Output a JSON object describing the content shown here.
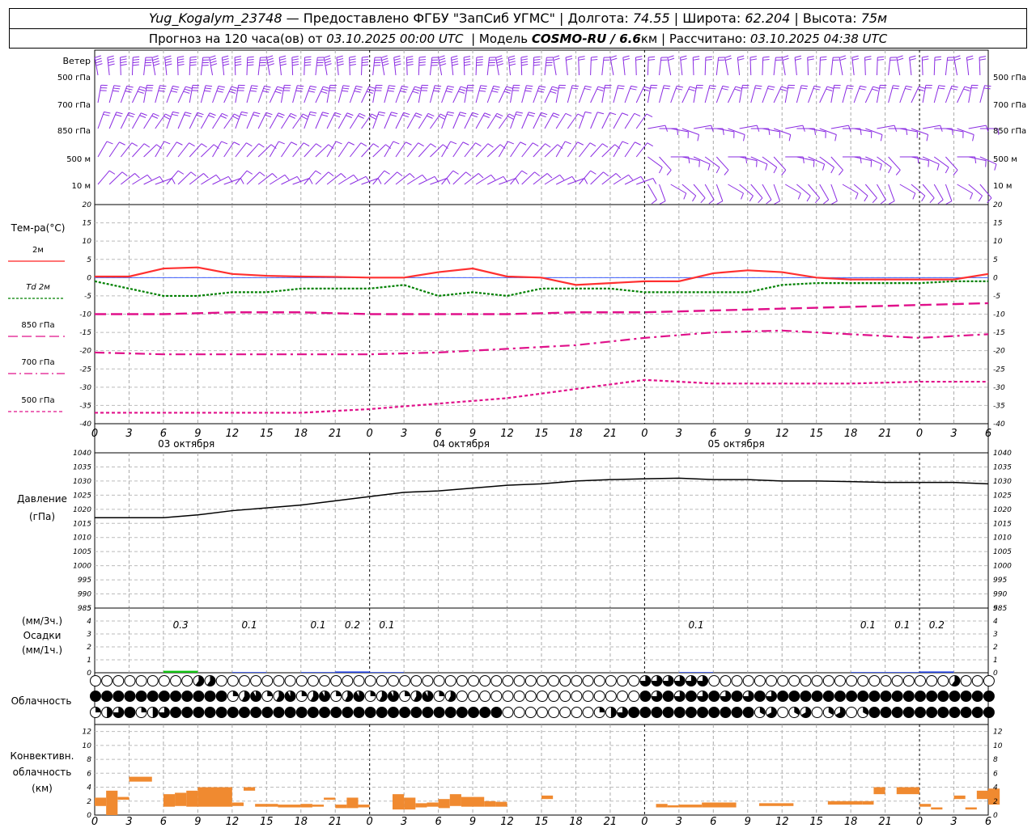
{
  "header": {
    "station": "Yug_Kogalym_23748",
    "provider": "— Предоставлено ФГБУ \"ЗапСиб УГМС\"",
    "lon_label": "Долгота:",
    "lon": "74.55",
    "lat_label": "Широта:",
    "lat": "62.204",
    "alt_label": "Высота:",
    "alt": "75м",
    "forecast_label": "Прогноз на 120 часа(ов) от",
    "forecast_start": "03.10.2025 00:00 UTC",
    "model_label": "Модель",
    "model": "COSMO-RU / 6.6",
    "model_unit": "км",
    "calc_label": "Рассчитано:",
    "calc_time": "03.10.2025 04:38 UTC"
  },
  "axis": {
    "hours": [
      "0",
      "3",
      "6",
      "9",
      "12",
      "15",
      "18",
      "21",
      "0",
      "3",
      "6",
      "9",
      "12",
      "15",
      "18",
      "21",
      "0",
      "3",
      "6",
      "9",
      "12",
      "15",
      "18",
      "21",
      "0",
      "3",
      "6"
    ],
    "dates": [
      "03 октября",
      "04 октября",
      "05 октября"
    ]
  },
  "wind_panel": {
    "title": "Ветер",
    "levels": [
      "500 гПа",
      "700 гПа",
      "850 гПа",
      "500 м",
      "10  м"
    ],
    "color": "#8a2be2"
  },
  "temp_panel": {
    "ylabel": "Тем-ра(°C)",
    "ticks": [
      "20",
      "15",
      "10",
      "5",
      "0",
      "-5",
      "-10",
      "-15",
      "-20",
      "-25",
      "-30",
      "-35",
      "-40"
    ],
    "legend": [
      {
        "label": "2м",
        "color": "#ff2020"
      },
      {
        "label": "Td  2м",
        "color": "#008000"
      },
      {
        "label": "850 гПа",
        "color": "#e0108a"
      },
      {
        "label": "700 гПа",
        "color": "#e0108a"
      },
      {
        "label": "500 гПа",
        "color": "#e0108a"
      }
    ]
  },
  "pressure_panel": {
    "ylabel1": "Давление",
    "ylabel2": "(гПа)",
    "ticks": [
      "1040",
      "1035",
      "1030",
      "1025",
      "1020",
      "1015",
      "1010",
      "1005",
      "1000",
      "995",
      "990",
      "985"
    ]
  },
  "precip_panel": {
    "ylabel1": "(мм/3ч.)",
    "ylabel2": "Осадки",
    "ylabel3": "(мм/1ч.)",
    "ticks": [
      "5",
      "4",
      "3",
      "2",
      "1",
      "0"
    ],
    "labels": [
      {
        "hour": 9,
        "text": "0.3"
      },
      {
        "hour": 15,
        "text": "0.1"
      },
      {
        "hour": 21,
        "text": "0.1"
      },
      {
        "hour": 24,
        "text": "0.2"
      },
      {
        "hour": 27,
        "text": "0.1"
      },
      {
        "hour": 54,
        "text": "0.1"
      },
      {
        "hour": 69,
        "text": "0.1"
      },
      {
        "hour": 72,
        "text": "0.1"
      },
      {
        "hour": 75,
        "text": "0.2"
      }
    ]
  },
  "cloud_panel": {
    "ylabel": "Облачность"
  },
  "conv_panel": {
    "ylabel1": "Конвективн.",
    "ylabel2": "облачность",
    "ylabel3": "(км)",
    "ticks": [
      "12",
      "10",
      "8",
      "6",
      "4",
      "2",
      "0"
    ],
    "color": "#f08a30"
  },
  "chart_data": [
    {
      "type": "line",
      "title": "Тем-ра(°C)",
      "x_unit": "hours from 03.10.2025 00:00 UTC",
      "ylim": [
        -40,
        20
      ],
      "series": [
        {
          "name": "2м",
          "x": [
            0,
            3,
            6,
            9,
            12,
            15,
            18,
            21,
            24,
            27,
            30,
            33,
            36,
            39,
            42,
            45,
            48,
            51,
            54,
            57,
            60,
            63,
            66,
            69,
            72,
            75,
            78
          ],
          "values": [
            0.3,
            0.3,
            2.5,
            2.8,
            1,
            0.5,
            0.3,
            0.2,
            0,
            0,
            1.5,
            2.5,
            0.3,
            0,
            -2,
            -1.5,
            -1,
            -1,
            1.2,
            2,
            1.5,
            0,
            -0.5,
            -0.5,
            -0.5,
            -0.5,
            1
          ]
        },
        {
          "name": "Td  2м",
          "x": [
            0,
            3,
            6,
            9,
            12,
            15,
            18,
            21,
            24,
            27,
            30,
            33,
            36,
            39,
            42,
            45,
            48,
            51,
            54,
            57,
            60,
            63,
            66,
            69,
            72,
            75,
            78
          ],
          "values": [
            -1,
            -3,
            -5,
            -5,
            -4,
            -4,
            -3,
            -3,
            -3,
            -2,
            -5,
            -4,
            -5,
            -3,
            -3,
            -3,
            -4,
            -4,
            -4,
            -4,
            -2,
            -1.5,
            -1.5,
            -1.5,
            -1.5,
            -1,
            -1
          ]
        },
        {
          "name": "850 гПа",
          "x": [
            0,
            6,
            12,
            18,
            24,
            30,
            36,
            42,
            48,
            54,
            60,
            66,
            72,
            78
          ],
          "values": [
            -10,
            -10,
            -9.5,
            -9.5,
            -10,
            -10,
            -10,
            -9.5,
            -9.5,
            -9,
            -8.5,
            -8,
            -7.5,
            -7
          ]
        },
        {
          "name": "700 гПа",
          "x": [
            0,
            6,
            12,
            18,
            24,
            30,
            36,
            42,
            48,
            54,
            60,
            66,
            72,
            78
          ],
          "values": [
            -20.5,
            -21,
            -21,
            -21,
            -21,
            -20.5,
            -19.5,
            -18.5,
            -16.5,
            -15,
            -14.5,
            -15.5,
            -16.5,
            -15.5
          ]
        },
        {
          "name": "500 гПа",
          "x": [
            0,
            6,
            12,
            18,
            24,
            30,
            36,
            42,
            48,
            54,
            60,
            66,
            72,
            78
          ],
          "values": [
            -37,
            -37,
            -37,
            -37,
            -36,
            -34.5,
            -33,
            -30.5,
            -28,
            -29,
            -29,
            -29,
            -28.5,
            -28.5
          ]
        }
      ]
    },
    {
      "type": "line",
      "title": "Давление (гПа)",
      "ylim": [
        985,
        1040
      ],
      "series": [
        {
          "name": "",
          "x": [
            0,
            3,
            6,
            9,
            12,
            15,
            18,
            21,
            24,
            27,
            30,
            33,
            36,
            39,
            42,
            45,
            48,
            51,
            54,
            57,
            60,
            63,
            66,
            69,
            72,
            75,
            78
          ],
          "values": [
            1017,
            1017,
            1017,
            1018,
            1019.5,
            1020.5,
            1021.5,
            1023,
            1024.5,
            1026,
            1026.5,
            1027.5,
            1028.5,
            1029,
            1030,
            1030.5,
            1030.8,
            1031,
            1030.5,
            1030.5,
            1030,
            1030,
            1029.8,
            1029.5,
            1029.5,
            1029.5,
            1029
          ]
        }
      ]
    },
    {
      "type": "bar",
      "title": "Осадки (мм/3ч.)",
      "ylim": [
        0,
        5
      ],
      "x": [
        9,
        15,
        21,
        24,
        27,
        54,
        69,
        72,
        75
      ],
      "values": [
        0.3,
        0.1,
        0.1,
        0.2,
        0.1,
        0.1,
        0.1,
        0.1,
        0.2
      ]
    },
    {
      "type": "bar",
      "title": "Конвективн. облачность (км)",
      "ylim": [
        0,
        13
      ],
      "bars": [
        {
          "x": [
            0,
            1
          ],
          "range": [
            1.3,
            2.5
          ]
        },
        {
          "x": [
            1,
            2
          ],
          "range": [
            0,
            3.5
          ]
        },
        {
          "x": [
            2,
            3
          ],
          "range": [
            2.2,
            2.6
          ]
        },
        {
          "x": [
            3,
            5
          ],
          "range": [
            4.8,
            5.5
          ]
        },
        {
          "x": [
            6,
            7
          ],
          "range": [
            1.2,
            3
          ]
        },
        {
          "x": [
            7,
            8
          ],
          "range": [
            1.3,
            3.2
          ]
        },
        {
          "x": [
            8,
            9
          ],
          "range": [
            1.2,
            3.5
          ]
        },
        {
          "x": [
            9,
            12
          ],
          "range": [
            1.2,
            4
          ]
        },
        {
          "x": [
            12,
            13
          ],
          "range": [
            1.3,
            1.8
          ]
        },
        {
          "x": [
            13,
            14
          ],
          "range": [
            3.5,
            4
          ]
        },
        {
          "x": [
            14,
            16
          ],
          "range": [
            1.2,
            1.6
          ]
        },
        {
          "x": [
            16,
            18
          ],
          "range": [
            1.1,
            1.5
          ]
        },
        {
          "x": [
            18,
            19
          ],
          "range": [
            1.1,
            1.6
          ]
        },
        {
          "x": [
            19,
            20
          ],
          "range": [
            1.2,
            1.5
          ]
        },
        {
          "x": [
            20,
            21
          ],
          "range": [
            2.2,
            2.5
          ]
        },
        {
          "x": [
            21,
            22
          ],
          "range": [
            1,
            1.5
          ]
        },
        {
          "x": [
            22,
            23
          ],
          "range": [
            1,
            2.5
          ]
        },
        {
          "x": [
            23,
            24
          ],
          "range": [
            1.1,
            1.5
          ]
        },
        {
          "x": [
            26,
            27
          ],
          "range": [
            0.8,
            3
          ]
        },
        {
          "x": [
            27,
            28
          ],
          "range": [
            0.8,
            2.5
          ]
        },
        {
          "x": [
            28,
            29
          ],
          "range": [
            1.1,
            1.7
          ]
        },
        {
          "x": [
            29,
            30
          ],
          "range": [
            1.2,
            1.8
          ]
        },
        {
          "x": [
            30,
            31
          ],
          "range": [
            1,
            2.3
          ]
        },
        {
          "x": [
            31,
            32
          ],
          "range": [
            1.3,
            3
          ]
        },
        {
          "x": [
            32,
            34
          ],
          "range": [
            1.2,
            2.6
          ]
        },
        {
          "x": [
            34,
            35
          ],
          "range": [
            1.2,
            2
          ]
        },
        {
          "x": [
            35,
            36
          ],
          "range": [
            1.2,
            1.9
          ]
        },
        {
          "x": [
            39,
            40
          ],
          "range": [
            2.3,
            2.8
          ]
        },
        {
          "x": [
            49,
            50
          ],
          "range": [
            1.1,
            1.6
          ]
        },
        {
          "x": [
            50,
            51
          ],
          "range": [
            1.1,
            1.4
          ]
        },
        {
          "x": [
            51,
            53
          ],
          "range": [
            1.1,
            1.5
          ]
        },
        {
          "x": [
            53,
            56
          ],
          "range": [
            1.1,
            1.8
          ]
        },
        {
          "x": [
            58,
            61
          ],
          "range": [
            1.3,
            1.7
          ]
        },
        {
          "x": [
            64,
            67
          ],
          "range": [
            1.5,
            2
          ]
        },
        {
          "x": [
            67,
            68
          ],
          "range": [
            1.5,
            2
          ]
        },
        {
          "x": [
            68,
            69
          ],
          "range": [
            3,
            4
          ]
        },
        {
          "x": [
            70,
            72
          ],
          "range": [
            3,
            4
          ]
        },
        {
          "x": [
            72,
            73
          ],
          "range": [
            1.2,
            1.6
          ]
        },
        {
          "x": [
            73,
            74
          ],
          "range": [
            0.8,
            1.1
          ]
        },
        {
          "x": [
            75,
            76
          ],
          "range": [
            2.3,
            2.8
          ]
        },
        {
          "x": [
            76,
            77
          ],
          "range": [
            0.8,
            1.1
          ]
        },
        {
          "x": [
            77,
            78
          ],
          "range": [
            2.3,
            3.5
          ]
        },
        {
          "x": [
            78,
            79
          ],
          "range": [
            1.5,
            3.8
          ]
        }
      ]
    }
  ]
}
